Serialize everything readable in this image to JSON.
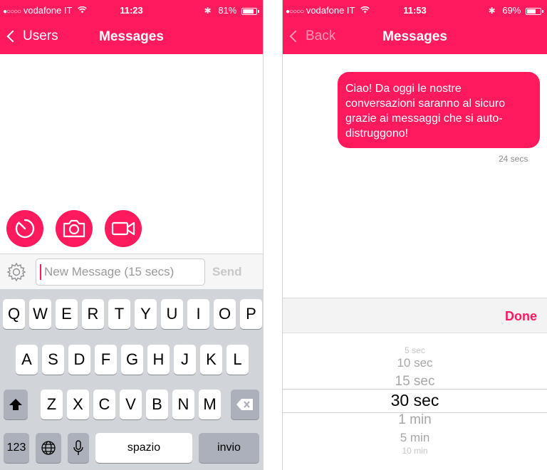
{
  "colors": {
    "accent": "#ff1a5e",
    "keyboard_bg": "#d1d4d9",
    "disabled": "#c8c8c8"
  },
  "left": {
    "status": {
      "carrier": "vodafone IT",
      "time": "11:23",
      "battery": "81%",
      "battery_level": 0.81
    },
    "nav": {
      "back_label": "Users",
      "title": "Messages"
    },
    "actions": [
      {
        "name": "timer-button",
        "icon": "timer-icon"
      },
      {
        "name": "camera-button",
        "icon": "camera-icon"
      },
      {
        "name": "video-button",
        "icon": "video-camera-icon"
      }
    ],
    "composer": {
      "placeholder": "New Message (15 secs)",
      "send_label": "Send",
      "settings_icon": "gear-icon"
    },
    "keyboard": {
      "row1": [
        "Q",
        "W",
        "E",
        "R",
        "T",
        "Y",
        "U",
        "I",
        "O",
        "P"
      ],
      "row2": [
        "A",
        "S",
        "D",
        "F",
        "G",
        "H",
        "J",
        "K",
        "L"
      ],
      "row3": [
        "Z",
        "X",
        "C",
        "V",
        "B",
        "N",
        "M"
      ],
      "shift_icon": "shift-icon",
      "backspace_icon": "backspace-icon",
      "numbers_label": "123",
      "globe_icon": "globe-icon",
      "mic_icon": "microphone-icon",
      "space_label": "spazio",
      "return_label": "invio"
    }
  },
  "right": {
    "status": {
      "carrier": "vodafone IT",
      "time": "11:53",
      "battery": "69%",
      "battery_level": 0.69
    },
    "nav": {
      "back_label": "Back",
      "title": "Messages"
    },
    "message": {
      "text": "Ciao! Da oggi le nostre conversazioni saranno al sicuro grazie ai messaggi che si auto-distruggono!",
      "timestamp": "24 secs"
    },
    "picker": {
      "done_label": "Done",
      "options": [
        "5 sec",
        "10 sec",
        "15 sec",
        "30 sec",
        "1 min",
        "5 min",
        "10 min"
      ],
      "selected": "30 sec"
    }
  }
}
